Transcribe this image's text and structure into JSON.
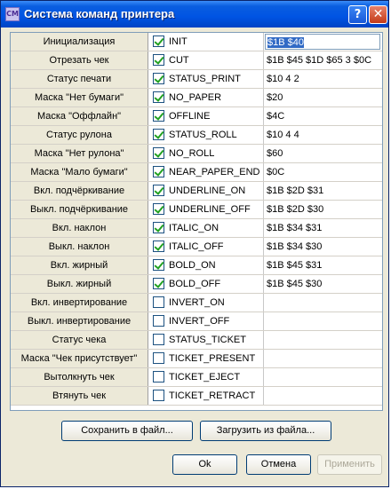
{
  "window": {
    "title": "Система команд принтера",
    "app_icon_text": "CM",
    "help_glyph": "?",
    "close_glyph": "✕"
  },
  "commands": [
    {
      "label": "Инициализация",
      "checked": true,
      "name": "INIT",
      "value": "$1B $40",
      "active": true
    },
    {
      "label": "Отрезать чек",
      "checked": true,
      "name": "CUT",
      "value": "$1B $45 $1D $65 3 $0C"
    },
    {
      "label": "Статус печати",
      "checked": true,
      "name": "STATUS_PRINT",
      "value": "$10 4 2"
    },
    {
      "label": "Маска \"Нет бумаги\"",
      "checked": true,
      "name": "NO_PAPER",
      "value": "$20"
    },
    {
      "label": "Маска \"Оффлайн\"",
      "checked": true,
      "name": "OFFLINE",
      "value": "$4C"
    },
    {
      "label": "Статус рулона",
      "checked": true,
      "name": "STATUS_ROLL",
      "value": "$10 4 4"
    },
    {
      "label": "Маска \"Нет рулона\"",
      "checked": true,
      "name": "NO_ROLL",
      "value": "$60"
    },
    {
      "label": "Маска \"Мало бумаги\"",
      "checked": true,
      "name": "NEAR_PAPER_END",
      "value": "$0C"
    },
    {
      "label": "Вкл. подчёркивание",
      "checked": true,
      "name": "UNDERLINE_ON",
      "value": "$1B $2D $31"
    },
    {
      "label": "Выкл. подчёркивание",
      "checked": true,
      "name": "UNDERLINE_OFF",
      "value": "$1B $2D $30"
    },
    {
      "label": "Вкл. наклон",
      "checked": true,
      "name": "ITALIC_ON",
      "value": "$1B $34 $31"
    },
    {
      "label": "Выкл. наклон",
      "checked": true,
      "name": "ITALIC_OFF",
      "value": "$1B $34 $30"
    },
    {
      "label": "Вкл. жирный",
      "checked": true,
      "name": "BOLD_ON",
      "value": "$1B $45 $31"
    },
    {
      "label": "Выкл. жирный",
      "checked": true,
      "name": "BOLD_OFF",
      "value": "$1B $45 $30"
    },
    {
      "label": "Вкл. инвертирование",
      "checked": false,
      "name": "INVERT_ON",
      "value": ""
    },
    {
      "label": "Выкл. инвертирование",
      "checked": false,
      "name": "INVERT_OFF",
      "value": ""
    },
    {
      "label": "Статус чека",
      "checked": false,
      "name": "STATUS_TICKET",
      "value": ""
    },
    {
      "label": "Маска \"Чек присутствует\"",
      "checked": false,
      "name": "TICKET_PRESENT",
      "value": ""
    },
    {
      "label": "Вытолкнуть чек",
      "checked": false,
      "name": "TICKET_EJECT",
      "value": ""
    },
    {
      "label": "Втянуть чек",
      "checked": false,
      "name": "TICKET_RETRACT",
      "value": ""
    }
  ],
  "buttons": {
    "save": "Сохранить в файл...",
    "load": "Загрузить из файла...",
    "ok": "Ok",
    "cancel": "Отмена",
    "apply": "Применить"
  },
  "colors": {
    "title_bar": "#0054e3",
    "check_mark": "#21a121",
    "selection": "#316ac5"
  }
}
